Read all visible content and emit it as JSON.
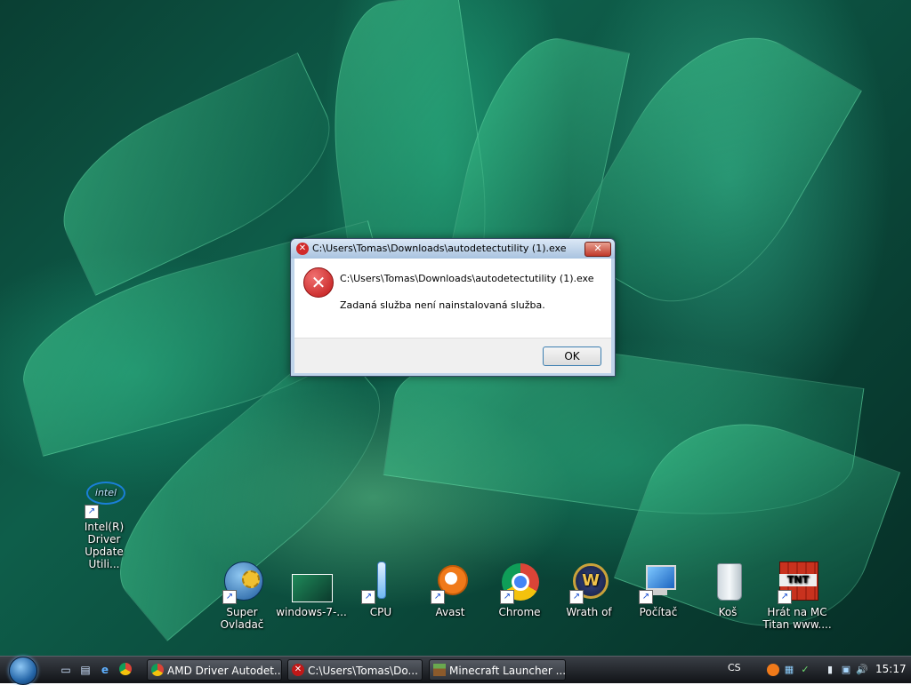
{
  "dialog": {
    "title": "C:\\Users\\Tomas\\Downloads\\autodetectutility (1).exe",
    "message_path": "C:\\Users\\Tomas\\Downloads\\autodetectutility (1).exe",
    "message_text": "Zadaná služba není nainstalovaná služba.",
    "ok_label": "OK",
    "close_glyph": "✕",
    "error_glyph": "✕"
  },
  "desktop_icons": {
    "intel": {
      "label": "Intel(R) Driver Update Utili...",
      "icon": "intel-icon"
    },
    "super": {
      "label": "Super Ovladač",
      "icon": "gear-globe-icon"
    },
    "windows7": {
      "label": "windows-7-...",
      "icon": "image-thumbnail-icon"
    },
    "cpu": {
      "label": "CPU",
      "icon": "thermometer-icon"
    },
    "avast": {
      "label": "Avast",
      "icon": "avast-icon"
    },
    "chrome": {
      "label": "Chrome",
      "icon": "chrome-icon"
    },
    "wrath": {
      "label": "Wrath of",
      "icon": "wow-icon"
    },
    "pocitac": {
      "label": "Počítač",
      "icon": "computer-icon"
    },
    "kos": {
      "label": "Koš",
      "icon": "recycle-bin-icon"
    },
    "hrat": {
      "label": "Hrát na MC Titan www....",
      "icon": "tnt-icon"
    }
  },
  "taskbar": {
    "buttons": [
      {
        "label": "AMD Driver Autodet...",
        "icon": "chrome-icon"
      },
      {
        "label": "C:\\Users\\Tomas\\Do...",
        "icon": "error-icon"
      },
      {
        "label": "Minecraft Launcher ...",
        "icon": "minecraft-icon"
      }
    ],
    "language": "CS",
    "clock": "15:17"
  },
  "colors": {
    "error_red": "#c01818",
    "taskbar_dark": "#111317",
    "dialog_frame": "#bfd4ea"
  }
}
